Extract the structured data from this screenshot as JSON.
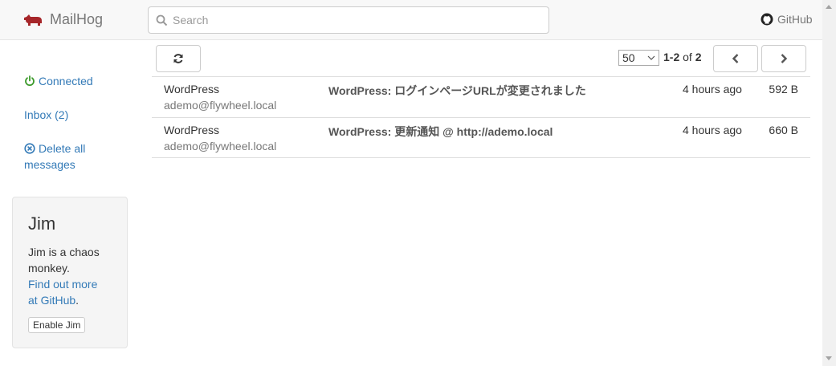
{
  "brand": {
    "name": "MailHog",
    "accent": "#a6262a"
  },
  "search": {
    "placeholder": "Search",
    "value": ""
  },
  "github": {
    "label": "GitHub"
  },
  "sidebar": {
    "connected": "Connected",
    "inbox": "Inbox (2)",
    "delete_all_line1": "Delete all",
    "delete_all_line2": "messages",
    "status_color": "#3c9a2b"
  },
  "jim": {
    "title": "Jim",
    "desc_line1": "Jim is a chaos",
    "desc_line2": "monkey.",
    "link_line1": "Find out more",
    "link_line2": "at GitHub",
    "period": ".",
    "button": "Enable Jim"
  },
  "toolbar": {
    "per_page": "50",
    "range_start_end": "1-2",
    "range_of": "of",
    "range_total": "2",
    "icons": [
      "refresh-icon",
      "chevron-left-icon",
      "chevron-right-icon"
    ]
  },
  "messages": [
    {
      "from_name": "WordPress",
      "from_email": "ademo@flywheel.local",
      "subject": "WordPress: ログインページURLが変更されました",
      "time": "4 hours ago",
      "size": "592 B"
    },
    {
      "from_name": "WordPress",
      "from_email": "ademo@flywheel.local",
      "subject": "WordPress: 更新通知 @ http://ademo.local",
      "time": "4 hours ago",
      "size": "660 B"
    }
  ]
}
